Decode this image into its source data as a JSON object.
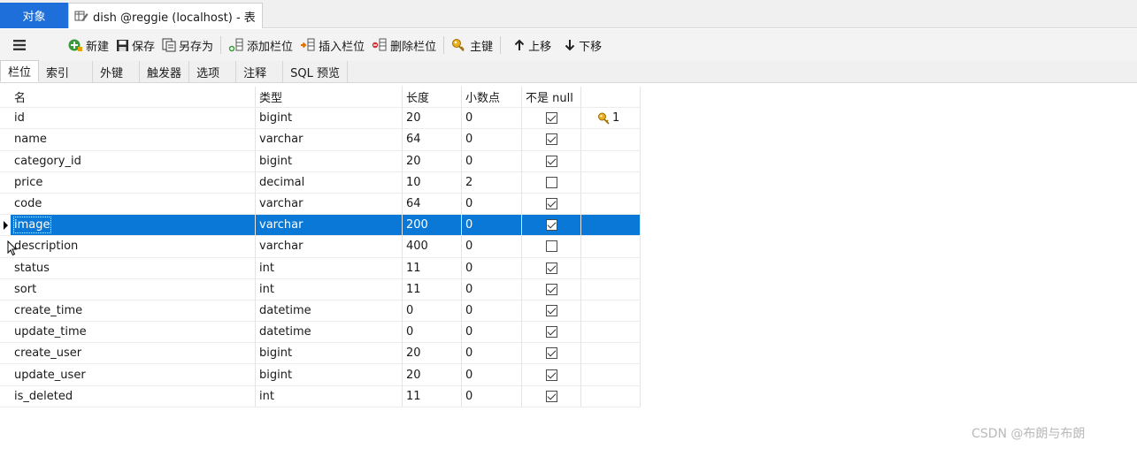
{
  "window": {
    "objects_tab": "对象",
    "doc_tab": "dish @reggie (localhost) - 表"
  },
  "toolbar": {
    "new": "新建",
    "save": "保存",
    "save_as": "另存为",
    "add_column": "添加栏位",
    "insert_column": "插入栏位",
    "delete_column": "删除栏位",
    "primary_key": "主键",
    "move_up": "上移",
    "move_down": "下移"
  },
  "subtabs": [
    "栏位",
    "索引",
    "外键",
    "触发器",
    "选项",
    "注释",
    "SQL 预览"
  ],
  "columns": {
    "name": "名",
    "type": "类型",
    "length": "长度",
    "decimals": "小数点",
    "not_null": "不是 null"
  },
  "rows": [
    {
      "name": "id",
      "type": "bigint",
      "length": "20",
      "decimals": "0",
      "not_null": true,
      "key": "1"
    },
    {
      "name": "name",
      "type": "varchar",
      "length": "64",
      "decimals": "0",
      "not_null": true,
      "key": ""
    },
    {
      "name": "category_id",
      "type": "bigint",
      "length": "20",
      "decimals": "0",
      "not_null": true,
      "key": ""
    },
    {
      "name": "price",
      "type": "decimal",
      "length": "10",
      "decimals": "2",
      "not_null": false,
      "key": ""
    },
    {
      "name": "code",
      "type": "varchar",
      "length": "64",
      "decimals": "0",
      "not_null": true,
      "key": ""
    },
    {
      "name": "image",
      "type": "varchar",
      "length": "200",
      "decimals": "0",
      "not_null": true,
      "key": "",
      "selected": true
    },
    {
      "name": "description",
      "type": "varchar",
      "length": "400",
      "decimals": "0",
      "not_null": false,
      "key": ""
    },
    {
      "name": "status",
      "type": "int",
      "length": "11",
      "decimals": "0",
      "not_null": true,
      "key": ""
    },
    {
      "name": "sort",
      "type": "int",
      "length": "11",
      "decimals": "0",
      "not_null": true,
      "key": ""
    },
    {
      "name": "create_time",
      "type": "datetime",
      "length": "0",
      "decimals": "0",
      "not_null": true,
      "key": ""
    },
    {
      "name": "update_time",
      "type": "datetime",
      "length": "0",
      "decimals": "0",
      "not_null": true,
      "key": ""
    },
    {
      "name": "create_user",
      "type": "bigint",
      "length": "20",
      "decimals": "0",
      "not_null": true,
      "key": ""
    },
    {
      "name": "update_user",
      "type": "bigint",
      "length": "20",
      "decimals": "0",
      "not_null": true,
      "key": ""
    },
    {
      "name": "is_deleted",
      "type": "int",
      "length": "11",
      "decimals": "0",
      "not_null": true,
      "key": ""
    }
  ],
  "watermark": "CSDN @布朗与布朗",
  "colors": {
    "selection": "#0a78d7",
    "objects_tab": "#1e6fd9"
  }
}
